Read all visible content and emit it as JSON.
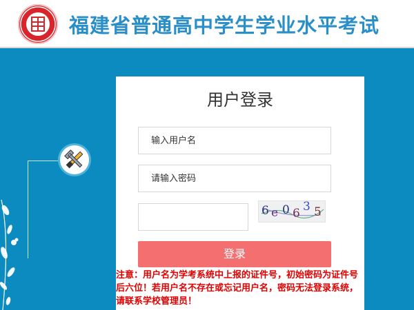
{
  "header": {
    "title": "福建省普通高中学生学业水平考试",
    "logo_icon": "school-seal-icon"
  },
  "login": {
    "title": "用户登录",
    "username_placeholder": "输入用户名",
    "password_placeholder": "请输入密码",
    "captcha_value": "",
    "captcha_chars": [
      "6",
      "e",
      "0",
      "6",
      "3",
      "5"
    ],
    "button_label": "登录",
    "notice": "注意：用户名为学考系统中上报的证件号，初始密码为证件号后六位！若用户名不存在或忘记用户名，密码无法登录系统，请联系学校管理员！"
  },
  "colors": {
    "brand_blue": "#0b8bc0",
    "title_blue": "#2a8fc8",
    "button": "#f46f6f",
    "notice_red": "#e10000"
  },
  "icons": {
    "tools": "tools-icon",
    "floral": "floral-decoration-icon"
  }
}
